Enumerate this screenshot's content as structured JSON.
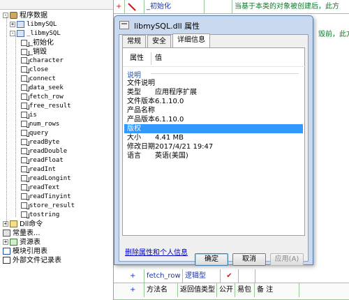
{
  "tree": {
    "items": [
      {
        "label": "程序数据",
        "indent": 0,
        "exp": "-",
        "icon": "db",
        "cn": true
      },
      {
        "label": "libmySQL",
        "indent": 1,
        "exp": "+",
        "icon": "cls",
        "cn": false
      },
      {
        "label": "_libmySQL",
        "indent": 1,
        "exp": "-",
        "icon": "cls",
        "cn": false
      },
      {
        "label": "_初始化",
        "indent": 2,
        "exp": "",
        "icon": "method",
        "cn": true
      },
      {
        "label": "_销毁",
        "indent": 2,
        "exp": "",
        "icon": "method",
        "cn": true
      },
      {
        "label": "character",
        "indent": 2,
        "exp": "",
        "icon": "method",
        "cn": false
      },
      {
        "label": "close",
        "indent": 2,
        "exp": "",
        "icon": "method",
        "cn": false
      },
      {
        "label": "connect",
        "indent": 2,
        "exp": "",
        "icon": "method",
        "cn": false
      },
      {
        "label": "data_seek",
        "indent": 2,
        "exp": "",
        "icon": "method",
        "cn": false
      },
      {
        "label": "fetch_row",
        "indent": 2,
        "exp": "",
        "icon": "method",
        "cn": false
      },
      {
        "label": "free_result",
        "indent": 2,
        "exp": "",
        "icon": "method",
        "cn": false
      },
      {
        "label": "is",
        "indent": 2,
        "exp": "",
        "icon": "method",
        "cn": false
      },
      {
        "label": "num_rows",
        "indent": 2,
        "exp": "",
        "icon": "method",
        "cn": false
      },
      {
        "label": "query",
        "indent": 2,
        "exp": "",
        "icon": "method",
        "cn": false
      },
      {
        "label": "readByte",
        "indent": 2,
        "exp": "",
        "icon": "method",
        "cn": false
      },
      {
        "label": "readDouble",
        "indent": 2,
        "exp": "",
        "icon": "method",
        "cn": false
      },
      {
        "label": "readFloat",
        "indent": 2,
        "exp": "",
        "icon": "method",
        "cn": false
      },
      {
        "label": "readInt",
        "indent": 2,
        "exp": "",
        "icon": "method",
        "cn": false
      },
      {
        "label": "readLongint",
        "indent": 2,
        "exp": "",
        "icon": "method",
        "cn": false
      },
      {
        "label": "readText",
        "indent": 2,
        "exp": "",
        "icon": "method",
        "cn": false
      },
      {
        "label": "readTinyint",
        "indent": 2,
        "exp": "",
        "icon": "method",
        "cn": false
      },
      {
        "label": "store_result",
        "indent": 2,
        "exp": "",
        "icon": "method",
        "cn": false
      },
      {
        "label": "tostring",
        "indent": 2,
        "exp": "",
        "icon": "method",
        "cn": false
      },
      {
        "label": "Dll命令",
        "indent": 0,
        "exp": "+",
        "icon": "dll",
        "cn": true
      },
      {
        "label": "常量表...",
        "indent": 0,
        "exp": "",
        "icon": "const",
        "cn": true
      },
      {
        "label": "资源表",
        "indent": 0,
        "exp": "+",
        "icon": "res",
        "cn": true
      },
      {
        "label": "模块引用表",
        "indent": 0,
        "exp": "",
        "icon": "mod",
        "cn": true
      },
      {
        "label": "外部文件记录表",
        "indent": 0,
        "exp": "",
        "icon": "ext",
        "cn": true
      }
    ]
  },
  "editor": {
    "row1": {
      "plus": "+",
      "name": "_初始化",
      "note": "当基于本类的对象被创建后，此方"
    },
    "row2_note": "毁前，此方法",
    "row3": {
      "plus": "+",
      "name": "fetch_row",
      "type": "逻辑型",
      "check": "✔"
    },
    "header": {
      "plus": "+",
      "cols": [
        "方法名",
        "返回值类型",
        "公开",
        "易包",
        "备 注"
      ]
    }
  },
  "dialog": {
    "title": "libmySQL.dll 属性",
    "tabs": [
      "常规",
      "安全",
      "详细信息"
    ],
    "active_tab": 2,
    "columns": {
      "property": "属性",
      "value": "值"
    },
    "group": "说明",
    "properties": [
      {
        "key": "文件说明",
        "value": ""
      },
      {
        "key": "类型",
        "value": "应用程序扩展"
      },
      {
        "key": "文件版本",
        "value": "6.1.10.0"
      },
      {
        "key": "产品名称",
        "value": ""
      },
      {
        "key": "产品版本",
        "value": "6.1.10.0"
      },
      {
        "key": "版权",
        "value": ""
      },
      {
        "key": "大小",
        "value": "4.41 MB"
      },
      {
        "key": "修改日期",
        "value": "2017/4/21 19:47"
      },
      {
        "key": "语言",
        "value": "英语(美国)"
      }
    ],
    "selected_property": 5,
    "remove_link": "删除属性和个人信息",
    "buttons": {
      "ok": "确定",
      "cancel": "取消",
      "apply": "应用(A)"
    }
  },
  "colors": {
    "tree_bg": "#ffffff",
    "dialog_frame": "#c9daf0",
    "selection": "#3399ff",
    "link": "#0000cc",
    "grid_line": "#9bc59b",
    "group_label": "#1e50b4"
  }
}
